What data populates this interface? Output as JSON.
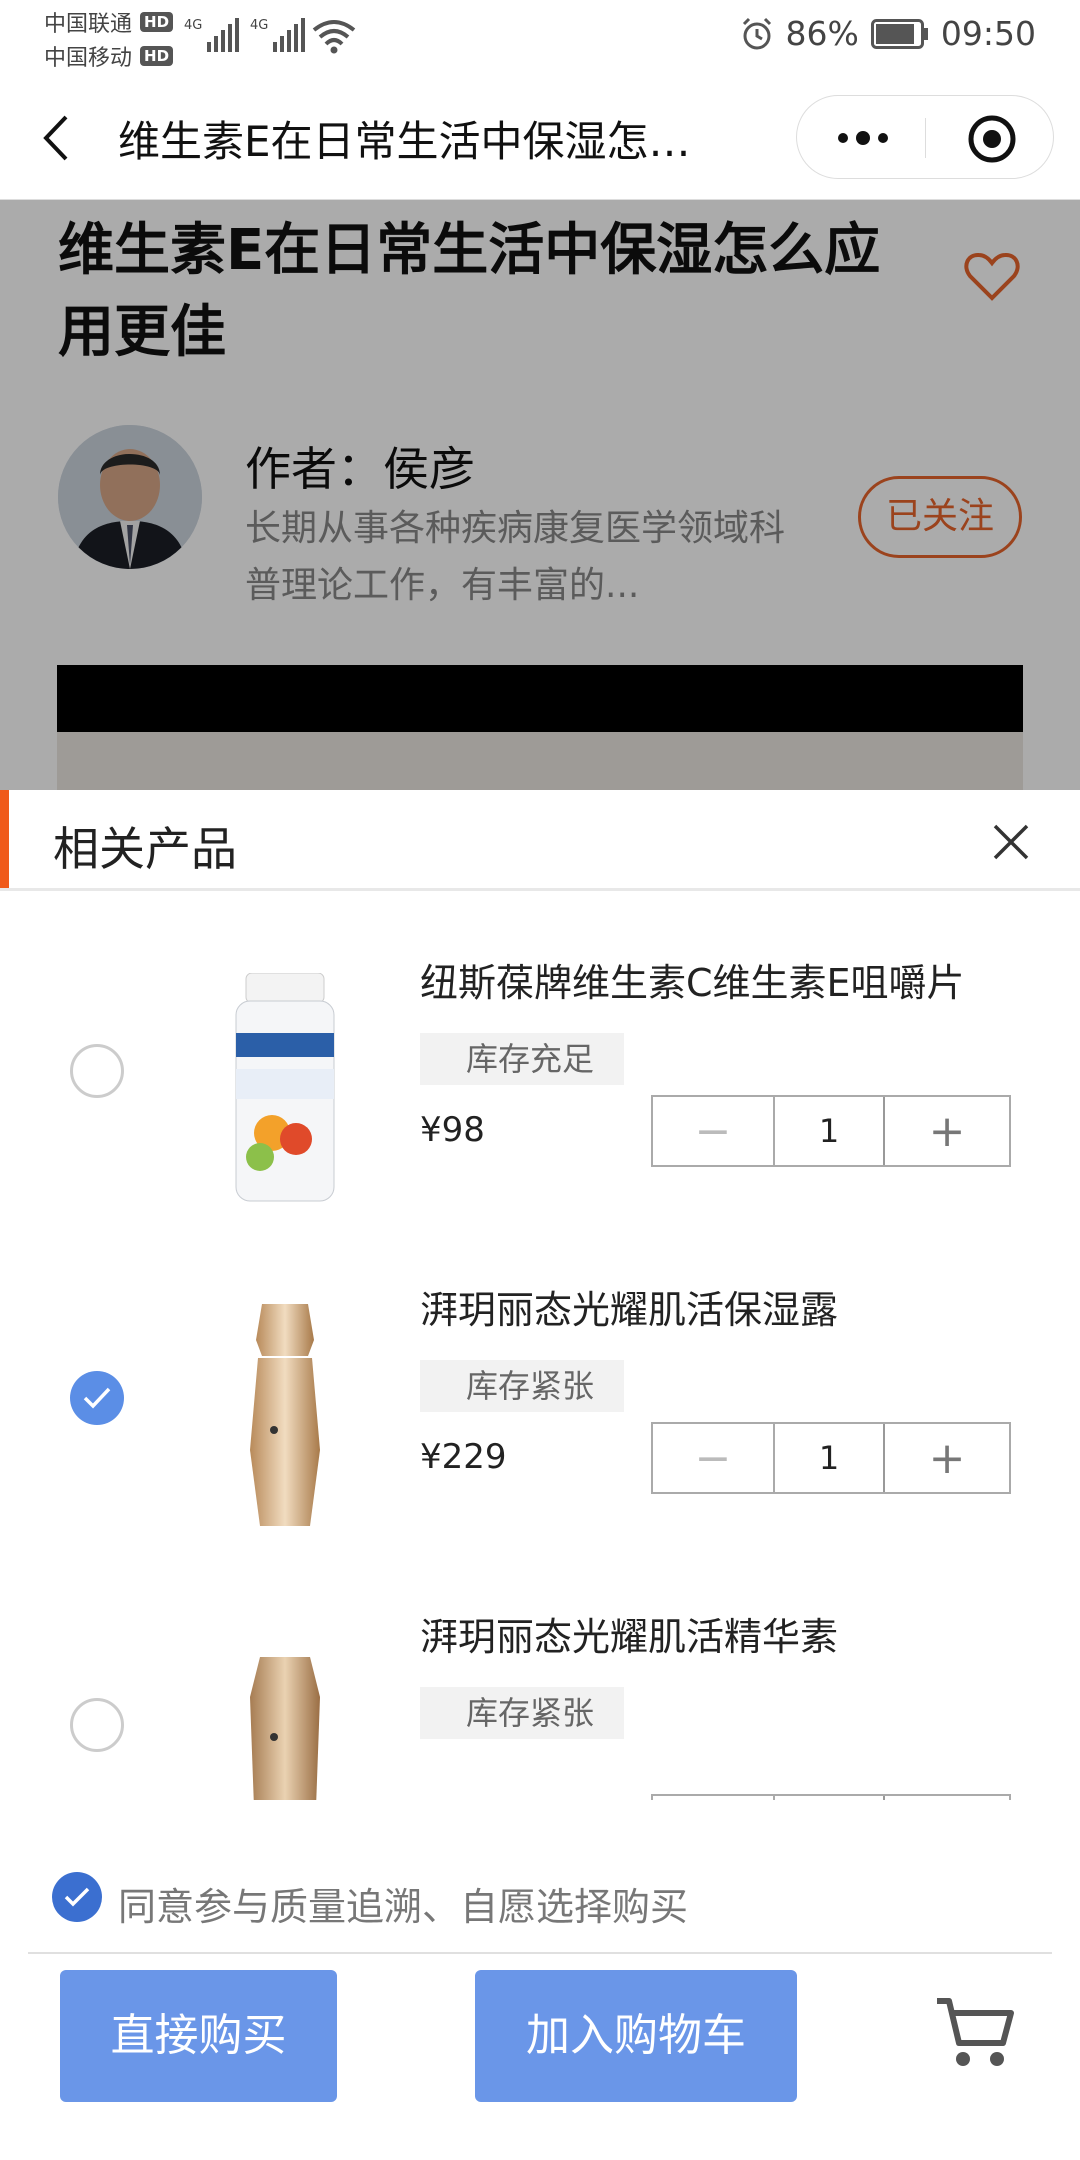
{
  "status_bar": {
    "carrier1": "中国联通",
    "carrier2": "中国移动",
    "hd": "HD",
    "network": "4G",
    "battery": "86%",
    "time": "09:50"
  },
  "nav": {
    "title": "维生素E在日常生活中保湿怎么应用更佳"
  },
  "article": {
    "title": "维生素E在日常生活中保湿怎么应用更佳",
    "author_name": "作者：侯彦",
    "author_bio": "长期从事各种疾病康复医学领域科普理论工作，有丰富的...",
    "follow_label": "已关注"
  },
  "sheet": {
    "title": "相关产品",
    "products": [
      {
        "name": "纽斯葆牌维生素C维生素E咀嚼片",
        "stock": "库存充足",
        "price": "¥98",
        "qty": "1",
        "selected": false
      },
      {
        "name": "湃玥丽态光耀肌活保湿露",
        "stock": "库存紧张",
        "price": "¥229",
        "qty": "1",
        "selected": true
      },
      {
        "name": "湃玥丽态光耀肌活精华素",
        "stock": "库存紧张",
        "price": "",
        "qty": "",
        "selected": false
      }
    ],
    "stepper_minus": "−",
    "stepper_plus": "+"
  },
  "footer": {
    "agree_text": "同意参与质量追溯、自愿选择购买",
    "agree_checked": true,
    "buy_now": "直接购买",
    "add_to_cart": "加入购物车"
  },
  "colors": {
    "accent": "#f05a1a",
    "follow": "#e8642c",
    "primary_button": "#6a96e8",
    "check": "#5b8ee6"
  },
  "icons": [
    "back-icon",
    "more-icon",
    "target-icon",
    "heart-icon",
    "close-icon",
    "check-icon",
    "cart-icon"
  ]
}
